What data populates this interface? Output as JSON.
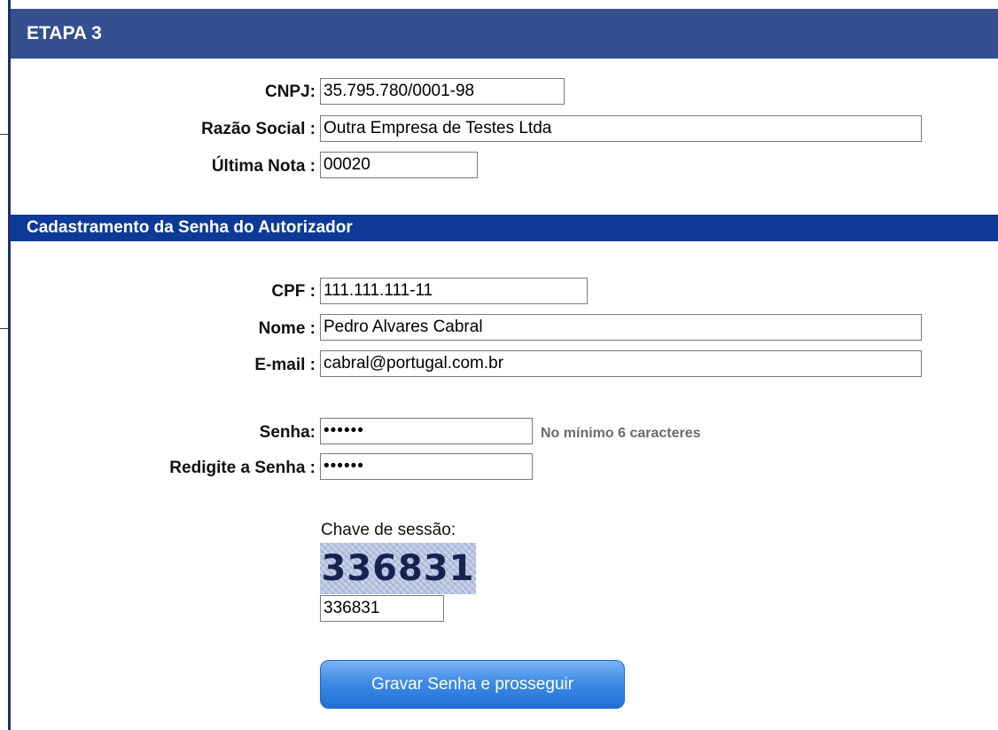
{
  "stage": {
    "title": "ETAPA 3"
  },
  "company": {
    "cnpj_label": "CNPJ:",
    "cnpj_value": "35.795.780/0001-98",
    "razao_label": "Razão Social :",
    "razao_value": "Outra Empresa de Testes Ltda",
    "ultima_nota_label": "Última Nota :",
    "ultima_nota_value": "00020"
  },
  "section": {
    "title": "Cadastramento da Senha do Autorizador"
  },
  "authorizer": {
    "cpf_label": "CPF :",
    "cpf_value": "111.111.111-11",
    "nome_label": "Nome :",
    "nome_value": "Pedro Alvares Cabral",
    "email_label": "E-mail :",
    "email_value": "cabral@portugal.com.br",
    "senha_label": "Senha:",
    "senha_value": "••••••",
    "senha_hint": "No mínimo 6 caracteres",
    "redigite_label": "Redigite a Senha :",
    "redigite_value": "••••••"
  },
  "captcha": {
    "label": "Chave de sessão:",
    "image_text": "336831",
    "input_value": "336831"
  },
  "actions": {
    "submit_label": "Gravar Senha e prosseguir"
  },
  "colors": {
    "header_bg": "#34508e",
    "section_bg": "#0d3a96",
    "button_bg": "#3f8be6"
  }
}
